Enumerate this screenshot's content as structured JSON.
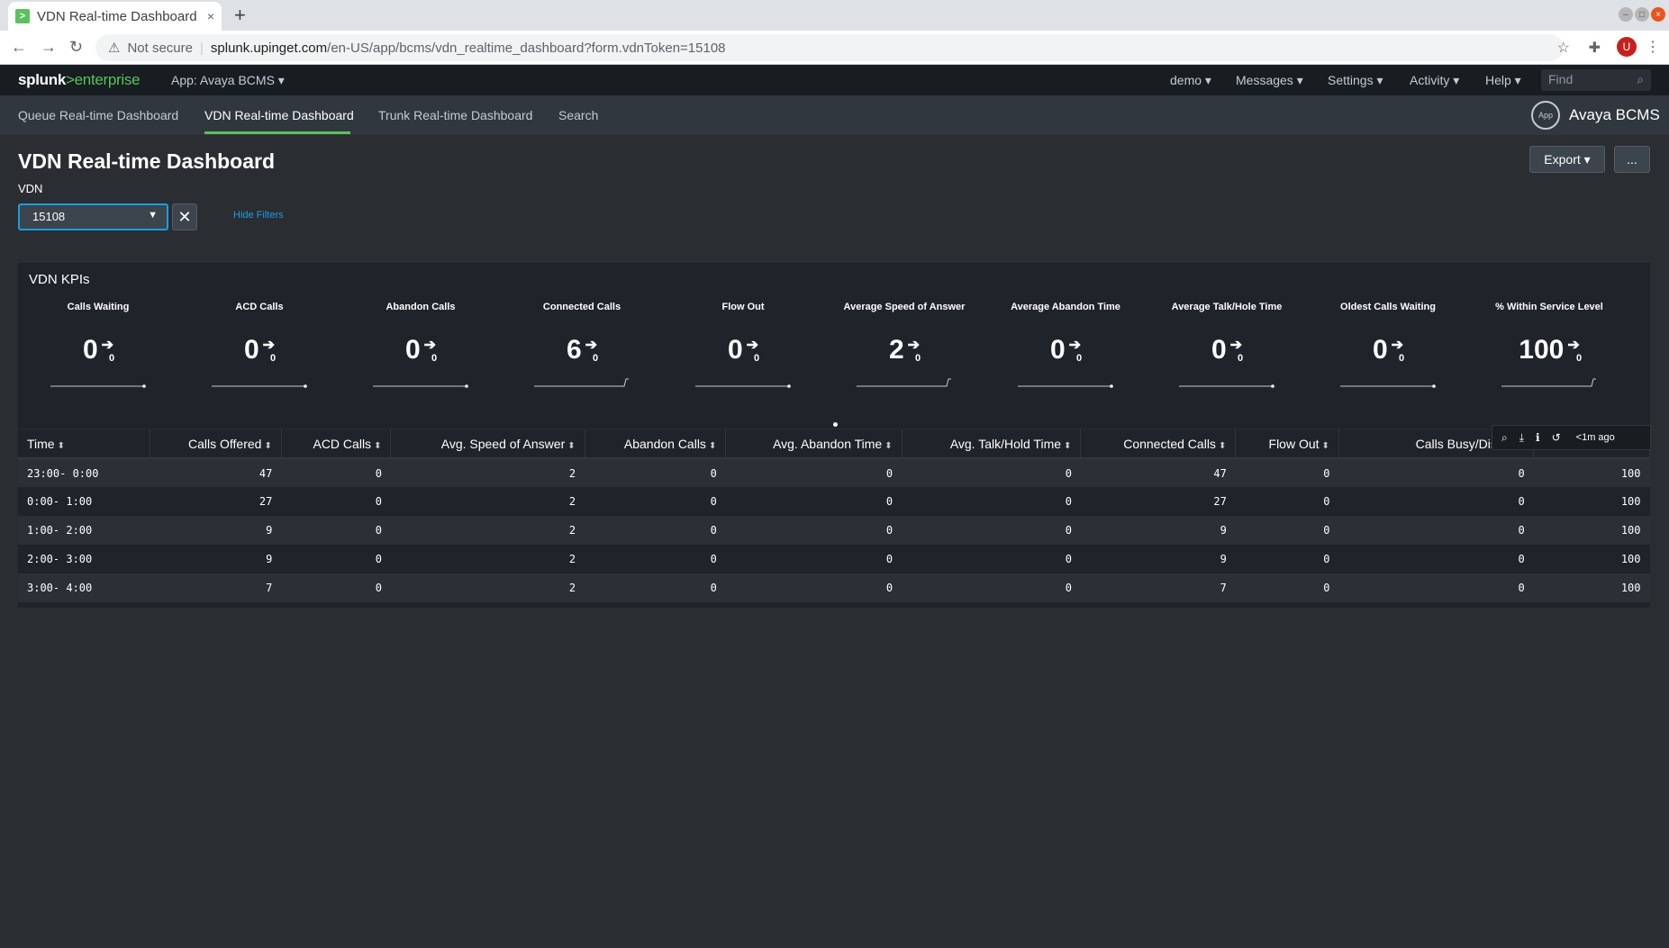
{
  "browser": {
    "tab_title": "VDN Real-time Dashboard",
    "tab_close": "×",
    "new_tab": "+",
    "not_secure": "Not secure",
    "url_host": "splunk.upinget.com",
    "url_path": "/en-US/app/bcms/vdn_realtime_dashboard?form.vdnToken=15108",
    "profile_initial": "U"
  },
  "splunk_bar": {
    "logo_splunk": "splunk",
    "logo_gt": ">",
    "logo_enterprise": "enterprise",
    "app_menu": "App: Avaya BCMS ▾",
    "menus": [
      "demo ▾",
      "Messages ▾",
      "Settings ▾",
      "Activity ▾",
      "Help ▾"
    ],
    "find_placeholder": "Find"
  },
  "app_nav": {
    "items": [
      "Queue Real-time Dashboard",
      "VDN Real-time Dashboard",
      "Trunk Real-time Dashboard",
      "Search"
    ],
    "active_index": 1,
    "app_icon_label": "App",
    "app_name": "Avaya BCMS"
  },
  "dashboard": {
    "title": "VDN Real-time Dashboard",
    "export_label": "Export ▾",
    "more_label": "...",
    "filter_label": "VDN",
    "filter_value": "15108",
    "hide_filters": "Hide Filters"
  },
  "kpis": {
    "panel_title": "VDN KPIs",
    "items": [
      {
        "label": "Calls Waiting",
        "value": "0",
        "delta": "0",
        "spark_end": "flat"
      },
      {
        "label": "ACD Calls",
        "value": "0",
        "delta": "0",
        "spark_end": "flat"
      },
      {
        "label": "Abandon Calls",
        "value": "0",
        "delta": "0",
        "spark_end": "flat"
      },
      {
        "label": "Connected Calls",
        "value": "6",
        "delta": "0",
        "spark_end": "step"
      },
      {
        "label": "Flow Out",
        "value": "0",
        "delta": "0",
        "spark_end": "flat"
      },
      {
        "label": "Average Speed of Answer",
        "value": "2",
        "delta": "0",
        "spark_end": "step"
      },
      {
        "label": "Average Abandon Time",
        "value": "0",
        "delta": "0",
        "spark_end": "flat"
      },
      {
        "label": "Average Talk/Hole Time",
        "value": "0",
        "delta": "0",
        "spark_end": "flat"
      },
      {
        "label": "Oldest Calls Waiting",
        "value": "0",
        "delta": "0",
        "spark_end": "flat"
      },
      {
        "label": "% Within Service Level",
        "value": "100",
        "delta": "0",
        "spark_end": "step"
      }
    ]
  },
  "table": {
    "columns": [
      "Time",
      "Calls Offered",
      "ACD Calls",
      "Avg. Speed of Answer",
      "Abandon Calls",
      "Avg. Abandon Time",
      "Avg. Talk/Hold Time",
      "Connected Calls",
      "Flow Out",
      "Calls Busy/Disconn",
      ""
    ],
    "rows": [
      [
        "23:00- 0:00",
        "47",
        "0",
        "2",
        "0",
        "0",
        "0",
        "47",
        "0",
        "0",
        "100"
      ],
      [
        "0:00- 1:00",
        "27",
        "0",
        "2",
        "0",
        "0",
        "0",
        "27",
        "0",
        "0",
        "100"
      ],
      [
        "1:00- 2:00",
        "9",
        "0",
        "2",
        "0",
        "0",
        "0",
        "9",
        "0",
        "0",
        "100"
      ],
      [
        "2:00- 3:00",
        "9",
        "0",
        "2",
        "0",
        "0",
        "0",
        "9",
        "0",
        "0",
        "100"
      ],
      [
        "3:00- 4:00",
        "7",
        "0",
        "2",
        "0",
        "0",
        "0",
        "7",
        "0",
        "0",
        "100"
      ]
    ],
    "last_refresh": "<1m ago"
  },
  "colors": {
    "accent_green": "#5cc05c",
    "link_blue": "#1a9fe0",
    "background": "#2a2d32",
    "panel": "#1f242a"
  }
}
